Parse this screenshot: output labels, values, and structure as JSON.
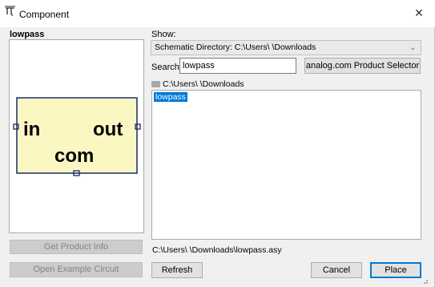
{
  "window": {
    "title": "Component",
    "close_glyph": "✕"
  },
  "preview": {
    "name": "lowpass",
    "symbol": {
      "pin_in": "in",
      "pin_out": "out",
      "pin_com": "com",
      "fill_color": "#fbf7c3"
    }
  },
  "show": {
    "label": "Show:",
    "selected": "Schematic Directory: C:\\Users\\        \\Downloads"
  },
  "search": {
    "label": "Search:",
    "value": "lowpass"
  },
  "buttons": {
    "product_selector": "analog.com Product Selector",
    "get_product_info": "Get Product Info",
    "open_example": "Open Example Circuit",
    "refresh": "Refresh",
    "cancel": "Cancel",
    "place": "Place"
  },
  "browser": {
    "current_dir": "C:\\Users\\         \\Downloads",
    "files": [
      {
        "name": "lowpass",
        "selected": true
      }
    ]
  },
  "selected_file_path": "C:\\Users\\         \\Downloads\\lowpass.asy",
  "colors": {
    "selection": "#0078d7",
    "disabled_button": "#cccccc"
  }
}
